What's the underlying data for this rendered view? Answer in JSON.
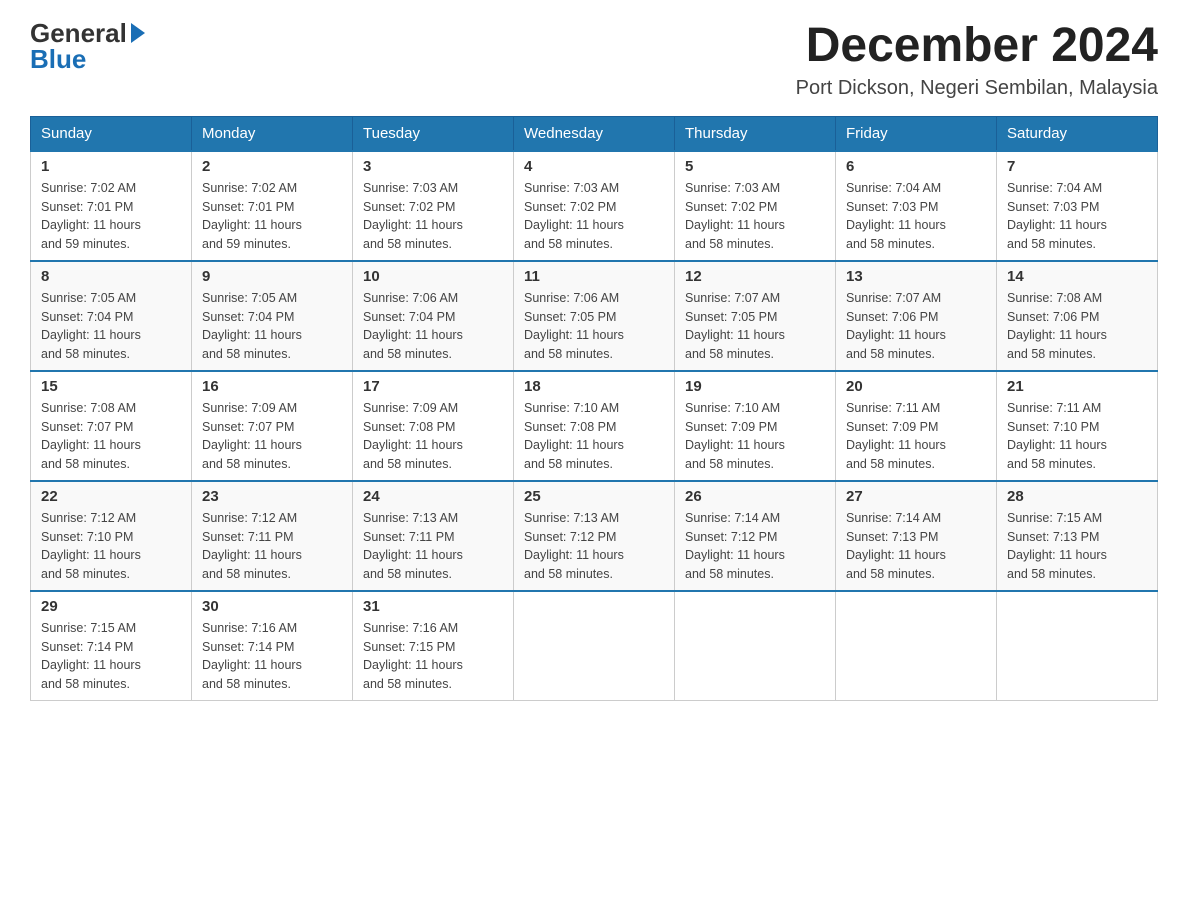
{
  "logo": {
    "general": "General",
    "blue": "Blue"
  },
  "title": "December 2024",
  "subtitle": "Port Dickson, Negeri Sembilan, Malaysia",
  "weekdays": [
    "Sunday",
    "Monday",
    "Tuesday",
    "Wednesday",
    "Thursday",
    "Friday",
    "Saturday"
  ],
  "weeks": [
    [
      {
        "day": "1",
        "sunrise": "7:02 AM",
        "sunset": "7:01 PM",
        "daylight": "11 hours and 59 minutes."
      },
      {
        "day": "2",
        "sunrise": "7:02 AM",
        "sunset": "7:01 PM",
        "daylight": "11 hours and 59 minutes."
      },
      {
        "day": "3",
        "sunrise": "7:03 AM",
        "sunset": "7:02 PM",
        "daylight": "11 hours and 58 minutes."
      },
      {
        "day": "4",
        "sunrise": "7:03 AM",
        "sunset": "7:02 PM",
        "daylight": "11 hours and 58 minutes."
      },
      {
        "day": "5",
        "sunrise": "7:03 AM",
        "sunset": "7:02 PM",
        "daylight": "11 hours and 58 minutes."
      },
      {
        "day": "6",
        "sunrise": "7:04 AM",
        "sunset": "7:03 PM",
        "daylight": "11 hours and 58 minutes."
      },
      {
        "day": "7",
        "sunrise": "7:04 AM",
        "sunset": "7:03 PM",
        "daylight": "11 hours and 58 minutes."
      }
    ],
    [
      {
        "day": "8",
        "sunrise": "7:05 AM",
        "sunset": "7:04 PM",
        "daylight": "11 hours and 58 minutes."
      },
      {
        "day": "9",
        "sunrise": "7:05 AM",
        "sunset": "7:04 PM",
        "daylight": "11 hours and 58 minutes."
      },
      {
        "day": "10",
        "sunrise": "7:06 AM",
        "sunset": "7:04 PM",
        "daylight": "11 hours and 58 minutes."
      },
      {
        "day": "11",
        "sunrise": "7:06 AM",
        "sunset": "7:05 PM",
        "daylight": "11 hours and 58 minutes."
      },
      {
        "day": "12",
        "sunrise": "7:07 AM",
        "sunset": "7:05 PM",
        "daylight": "11 hours and 58 minutes."
      },
      {
        "day": "13",
        "sunrise": "7:07 AM",
        "sunset": "7:06 PM",
        "daylight": "11 hours and 58 minutes."
      },
      {
        "day": "14",
        "sunrise": "7:08 AM",
        "sunset": "7:06 PM",
        "daylight": "11 hours and 58 minutes."
      }
    ],
    [
      {
        "day": "15",
        "sunrise": "7:08 AM",
        "sunset": "7:07 PM",
        "daylight": "11 hours and 58 minutes."
      },
      {
        "day": "16",
        "sunrise": "7:09 AM",
        "sunset": "7:07 PM",
        "daylight": "11 hours and 58 minutes."
      },
      {
        "day": "17",
        "sunrise": "7:09 AM",
        "sunset": "7:08 PM",
        "daylight": "11 hours and 58 minutes."
      },
      {
        "day": "18",
        "sunrise": "7:10 AM",
        "sunset": "7:08 PM",
        "daylight": "11 hours and 58 minutes."
      },
      {
        "day": "19",
        "sunrise": "7:10 AM",
        "sunset": "7:09 PM",
        "daylight": "11 hours and 58 minutes."
      },
      {
        "day": "20",
        "sunrise": "7:11 AM",
        "sunset": "7:09 PM",
        "daylight": "11 hours and 58 minutes."
      },
      {
        "day": "21",
        "sunrise": "7:11 AM",
        "sunset": "7:10 PM",
        "daylight": "11 hours and 58 minutes."
      }
    ],
    [
      {
        "day": "22",
        "sunrise": "7:12 AM",
        "sunset": "7:10 PM",
        "daylight": "11 hours and 58 minutes."
      },
      {
        "day": "23",
        "sunrise": "7:12 AM",
        "sunset": "7:11 PM",
        "daylight": "11 hours and 58 minutes."
      },
      {
        "day": "24",
        "sunrise": "7:13 AM",
        "sunset": "7:11 PM",
        "daylight": "11 hours and 58 minutes."
      },
      {
        "day": "25",
        "sunrise": "7:13 AM",
        "sunset": "7:12 PM",
        "daylight": "11 hours and 58 minutes."
      },
      {
        "day": "26",
        "sunrise": "7:14 AM",
        "sunset": "7:12 PM",
        "daylight": "11 hours and 58 minutes."
      },
      {
        "day": "27",
        "sunrise": "7:14 AM",
        "sunset": "7:13 PM",
        "daylight": "11 hours and 58 minutes."
      },
      {
        "day": "28",
        "sunrise": "7:15 AM",
        "sunset": "7:13 PM",
        "daylight": "11 hours and 58 minutes."
      }
    ],
    [
      {
        "day": "29",
        "sunrise": "7:15 AM",
        "sunset": "7:14 PM",
        "daylight": "11 hours and 58 minutes."
      },
      {
        "day": "30",
        "sunrise": "7:16 AM",
        "sunset": "7:14 PM",
        "daylight": "11 hours and 58 minutes."
      },
      {
        "day": "31",
        "sunrise": "7:16 AM",
        "sunset": "7:15 PM",
        "daylight": "11 hours and 58 minutes."
      },
      null,
      null,
      null,
      null
    ]
  ],
  "sunrise_label": "Sunrise:",
  "sunset_label": "Sunset:",
  "daylight_label": "Daylight:"
}
